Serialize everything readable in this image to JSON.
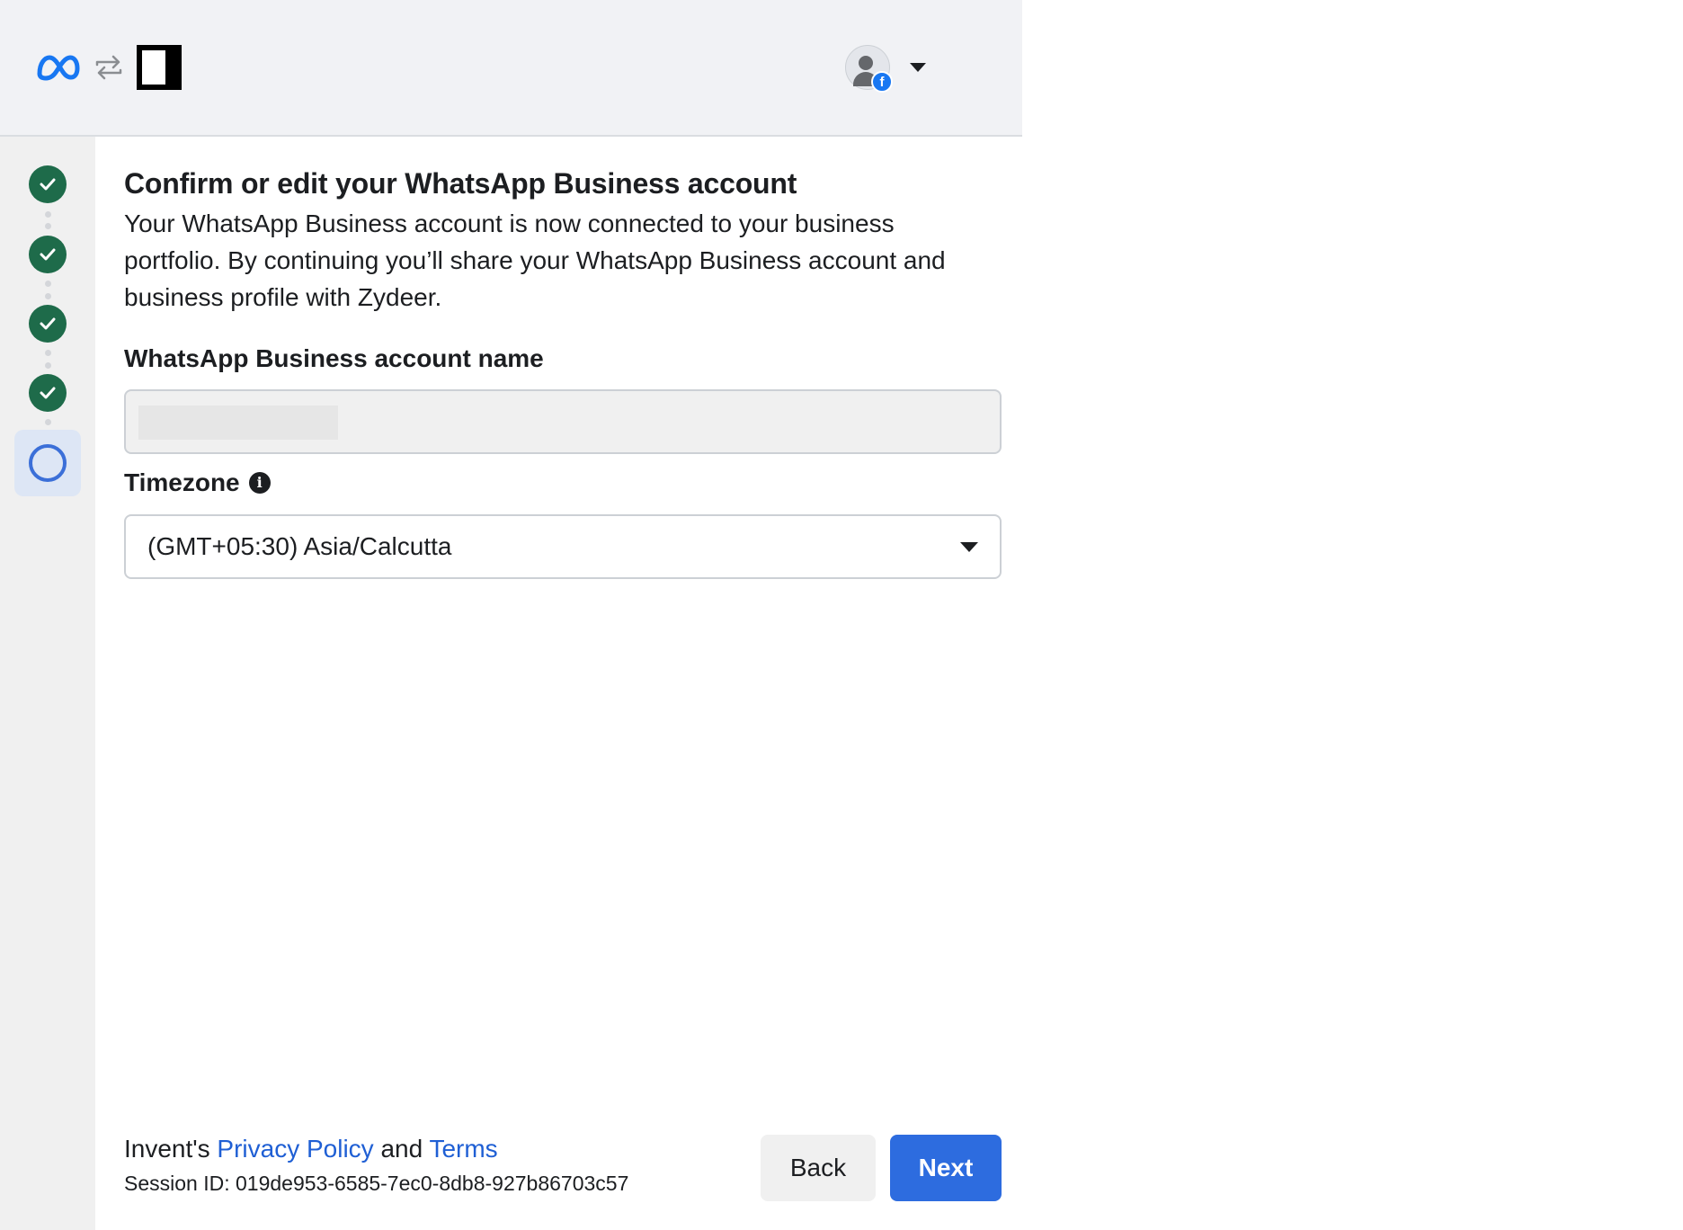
{
  "header": {
    "logo_icon": "meta-logo",
    "swap_icon": "swap-icon",
    "app_icon": "app-logo",
    "profile_icon": "avatar-facebook-badge",
    "dropdown_icon": "chevron-down-icon"
  },
  "stepper": {
    "steps": [
      {
        "state": "complete"
      },
      {
        "state": "complete"
      },
      {
        "state": "complete"
      },
      {
        "state": "complete"
      },
      {
        "state": "current"
      }
    ]
  },
  "main": {
    "title": "Confirm or edit your WhatsApp Business account",
    "description": "Your WhatsApp Business account is now connected to your business portfolio. By continuing you’ll share your WhatsApp Business account and business profile with Zydeer.",
    "account_name_label": "WhatsApp Business account name",
    "account_name_value": "",
    "timezone_label": "Timezone",
    "timezone_value": "(GMT+05:30) Asia/Calcutta"
  },
  "footer": {
    "prefix": "Invent's ",
    "privacy_link": "Privacy Policy",
    "and": " and ",
    "terms_link": "Terms",
    "session": "Session ID: 019de953-6585-7ec0-8db8-927b86703c57",
    "back_label": "Back",
    "next_label": "Next"
  },
  "colors": {
    "accent": "#2d6cdf",
    "link": "#1f5fd4",
    "step_complete": "#1e6b4a",
    "step_current": "#3b6fd8"
  }
}
